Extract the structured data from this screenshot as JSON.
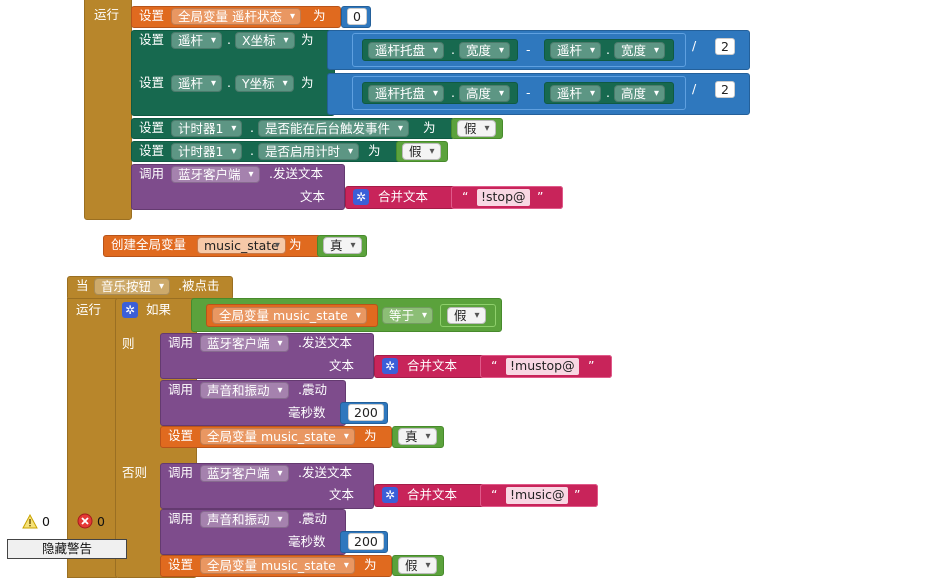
{
  "kw": {
    "run": "运行",
    "set": "设置",
    "to": "为",
    "call": "调用",
    "when": "当",
    "then": "则",
    "else": "否则",
    "if": "如果",
    "join": "合并文本",
    "text_param": "文本",
    "ms_param": "毫秒数",
    "init_global": "创建全局变量",
    "dot": ".",
    "minus": "-",
    "divide": "/",
    "quote_open": "“",
    "quote_close": "”"
  },
  "block1": {
    "global_joystick_state": "全局变量 遥杆状态",
    "zero": "0",
    "joystick": "遥杆",
    "x_coord": "X坐标",
    "y_coord": "Y坐标",
    "joystick_base": "遥杆托盘",
    "width": "宽度",
    "height": "高度",
    "two": "2",
    "timer": "计时器1",
    "bg_fire": "是否能在后台触发事件",
    "timer_enabled": "是否启用计时",
    "false": "假",
    "bt_client": "蓝牙客户端",
    "send_text": ".发送文本",
    "stop_str": "!stop@"
  },
  "global_var": {
    "name": "music_state",
    "value": "真"
  },
  "event": {
    "component": "音乐按钮",
    "event_name": ".被点击",
    "cond_var": "全局变量 music_state",
    "equals": "等于",
    "false": "假",
    "bt_client": "蓝牙客户端",
    "send_text": ".发送文本",
    "mustop_str": "!mustop@",
    "music_str": "!music@",
    "sound": "声音和振动",
    "vibrate": ".震动",
    "ms": "200",
    "set_var": "全局变量 music_state",
    "true_val": "真",
    "false_val": "假"
  },
  "workspace": {
    "warnings_count": "0",
    "errors_count": "0",
    "hide_warnings": "隐藏警告"
  }
}
